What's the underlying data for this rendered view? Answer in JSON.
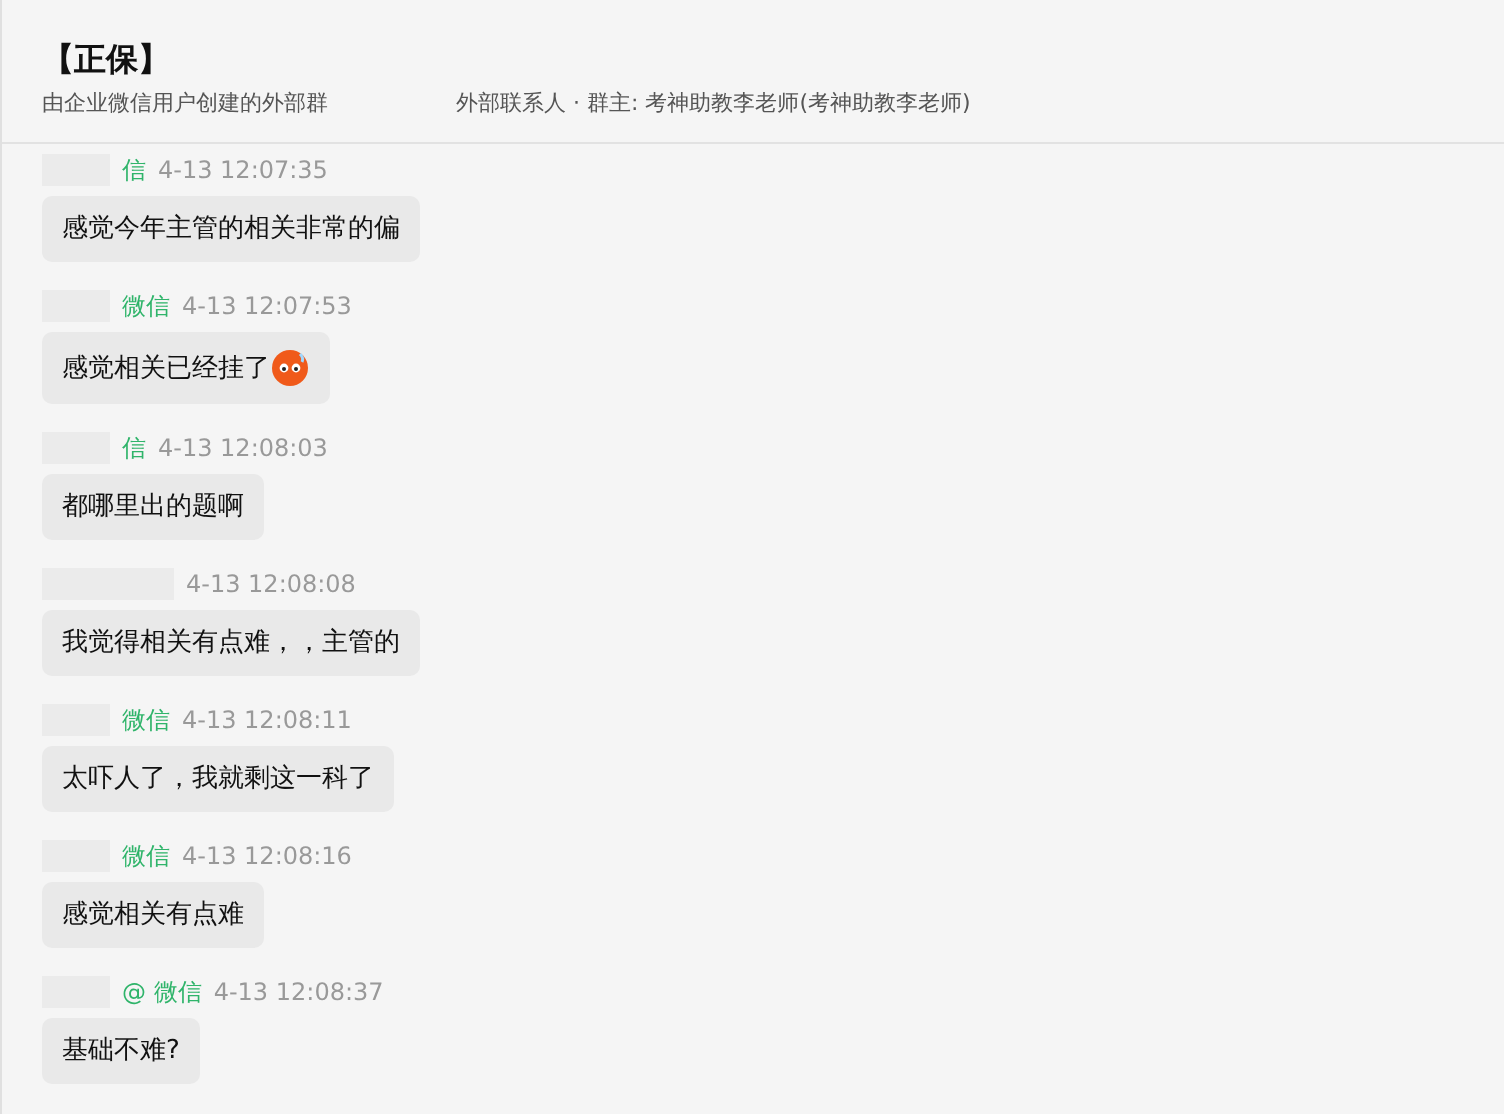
{
  "header": {
    "title": "【正保】",
    "subtitle_parts": [
      "由企业微信用户创建的外部群",
      "外部联系人 · 群主: 考神助教李老师(考神助教李老师)"
    ]
  },
  "messages": [
    {
      "sender": "信",
      "time": "4-13 12:07:35",
      "text": "感觉今年主管的相关非常的偏",
      "emoji": false
    },
    {
      "sender": "微信",
      "time": "4-13 12:07:53",
      "text": "感觉相关已经挂了",
      "emoji": true
    },
    {
      "sender": "信",
      "time": "4-13 12:08:03",
      "text": "都哪里出的题啊",
      "emoji": false
    },
    {
      "time": "4-13 12:08:08",
      "text": "我觉得相关有点难，，主管的",
      "emoji": false
    },
    {
      "sender": "微信",
      "time": "4-13 12:08:11",
      "text": "太吓人了，我就剩这一科了",
      "emoji": false
    },
    {
      "sender": "微信",
      "time": "4-13 12:08:16",
      "text": "感觉相关有点难",
      "emoji": false
    },
    {
      "sender": "@ 微信",
      "time": "4-13 12:08:37",
      "text": "基础不难?",
      "emoji": false
    }
  ]
}
